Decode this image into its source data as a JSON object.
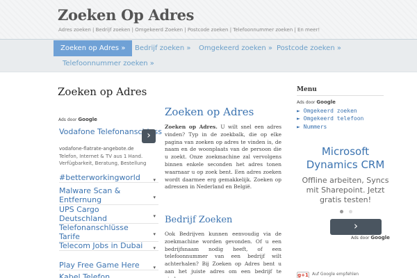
{
  "header": {
    "site_title": "Zoeken Op Adres",
    "site_description": "Adres zoeken | Bedrijf zoeken | Omgekeerd Zoeken | Postcode zoeken | Telefoonnummer zoeken | En meer!"
  },
  "nav": {
    "items": [
      {
        "label": "Zoeken op Adres »"
      },
      {
        "label": "Bedrijf zoeken »"
      },
      {
        "label": "Omgekeerd zoeken »"
      },
      {
        "label": "Postcode zoeken »"
      },
      {
        "label": "Telefoonnummer zoeken »"
      }
    ]
  },
  "page": {
    "title": "Zoeken op Adres"
  },
  "ads": {
    "label_prefix": "Ads door",
    "label_brand": "Google",
    "featured": {
      "title": "Vodafone Telefonanschluss",
      "url": "vodafone-flatrate-angebote.de",
      "text": "Telefon, Internet & TV aus 1 Hand. Verfügbarkeit, Beratung, Bestellung",
      "arrow": "›"
    },
    "links": [
      {
        "label": "#betterworkingworld",
        "chev": "▾"
      },
      {
        "label": "Malware Scan & Entfernung",
        "chev": "▾"
      },
      {
        "label": "UPS Cargo Deutschland",
        "chev": "▾"
      },
      {
        "label": "Telefonanschlüsse Tarife",
        "chev": "▾"
      },
      {
        "label": "Telecom Jobs in Dubai",
        "chev": "▾"
      },
      {
        "label": "Play Free Game Here",
        "chev": "▾"
      },
      {
        "label": "Kabel Telefon",
        "chev": "▾"
      }
    ]
  },
  "content": {
    "heading": "Zoeken op Adres",
    "intro_bold": "Zoeken op Adres.",
    "intro_rest": " U wilt snel een adres vinden? Typ in de zoekbalk, die op elke pagina van zoeken op adres te vinden is, de naam en de woonplaats van de persoon die u zoekt. Onze zoekmachine zal vervolgens binnen enkele seconden het adres tonen waarnaar u op zoek bent. Een adres zoeken wordt daarmee erg gemakkelijk. Zoeken op adressen in Nederland en België.",
    "subheading": "Bedrijf Zoeken",
    "para2": "Ook Bedrijven kunnen eenvoudig via de zoekmachine worden gevonden. Of u een bedrijfsnaam nodig heeft, of een telefoonnummer van een bedrijf wilt achterhalen? Bij Zoeken op Adres bent u aan het juiste adres om een bedrijf te vinden."
  },
  "sidebar": {
    "menu_title": "Menu",
    "ads_label_prefix": "Ads door",
    "ads_label_brand": "Google",
    "menu_links": [
      {
        "label": "► Omgekeerd zoeken"
      },
      {
        "label": "► Omgekeerd telefoon"
      },
      {
        "label": "► Nummers"
      }
    ],
    "ad": {
      "title": "Microsoft Dynamics CRM",
      "text": "Offline arbeiten, Syncs mit Sharepoint. Jetzt gratis testen!",
      "button_arrow": "›"
    },
    "bottom_ads_prefix": "Ads door",
    "bottom_ads_brand": "Google",
    "gplus_label": "g+1",
    "gplus_text": "Auf Google empfehlen"
  },
  "colors": {
    "link": "#3b73b0",
    "nav_active": "#6fa1d6",
    "nav_bg": "#e9ecee",
    "button_dark": "#4a5560"
  }
}
